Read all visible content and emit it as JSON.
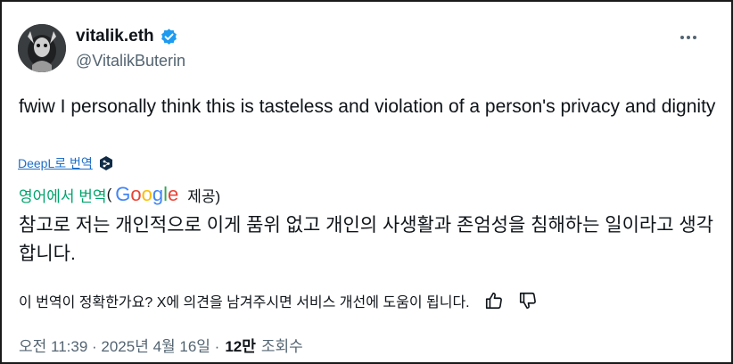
{
  "author": {
    "name": "vitalik.eth",
    "handle": "@VitalikButerin",
    "verified": true
  },
  "tweet": {
    "text": "fwiw I personally think this is tasteless and violation of a person's privacy and dignity"
  },
  "deepl_link": "DeepL로 번역",
  "translation": {
    "from_label": "영어에서 번역",
    "open_paren": "(",
    "google_logo": "Google",
    "provided_by": "제공)",
    "text": "참고로 저는 개인적으로 이게 품위 없고 개인의 사생활과 존엄성을 침해하는 일이라고 생각합니다.",
    "feedback_prompt": "이 번역이 정확한가요? X에 의견을 남겨주시면 서비스 개선에 도움이 됩니다."
  },
  "meta": {
    "timestamp": "오전 11:39 · 2025년 4월 16일 ·",
    "views_count": "12만",
    "views_label": "조회수"
  },
  "icons": {
    "more": "more-icon",
    "verified": "verified-badge-icon",
    "thumbs_up": "thumbs-up-icon",
    "thumbs_down": "thumbs-down-icon",
    "deepl": "deepl-icon"
  },
  "colors": {
    "accent_blue": "#1d9bf0",
    "translated_green": "#00a36c",
    "secondary_text": "#536471"
  }
}
